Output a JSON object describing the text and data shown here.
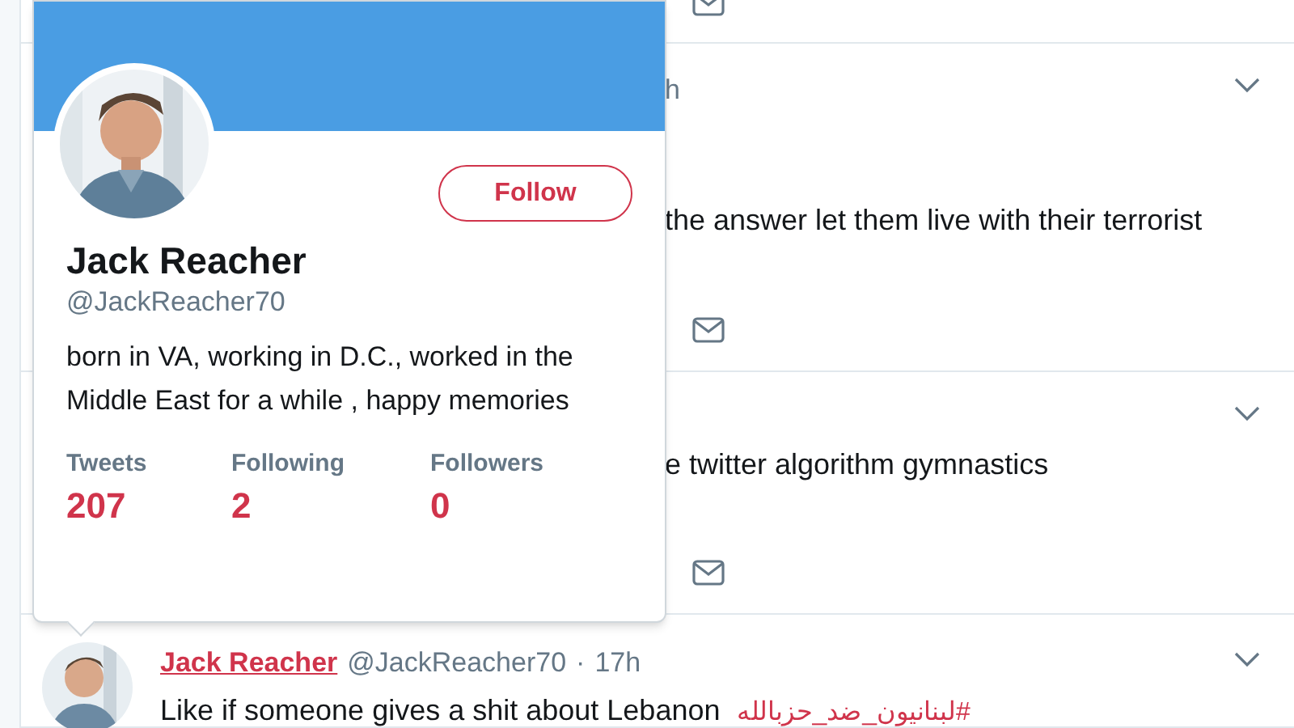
{
  "feed": [
    {
      "kind": "cut_top"
    },
    {
      "kind": "partial",
      "timestamp": "h",
      "text": "the answer let them live with their terrorist"
    },
    {
      "kind": "partial",
      "text": "e twitter algorithm gymnastics"
    },
    {
      "kind": "tweet",
      "name": "Jack Reacher",
      "handle": "@JackReacher70",
      "separator": "·",
      "timestamp": "17h",
      "text": "Like if someone gives a shit about Lebanon",
      "hashtag": "#لبنانيون_ضد_حزبالله"
    }
  ],
  "profile_card": {
    "follow_button": "Follow",
    "name": "Jack Reacher",
    "handle": "@JackReacher70",
    "bio": "born in VA, working in D.C., worked in the Middle East for a while , happy memories",
    "stats": [
      {
        "label": "Tweets",
        "value": "207"
      },
      {
        "label": "Following",
        "value": "2"
      },
      {
        "label": "Followers",
        "value": "0"
      }
    ]
  }
}
